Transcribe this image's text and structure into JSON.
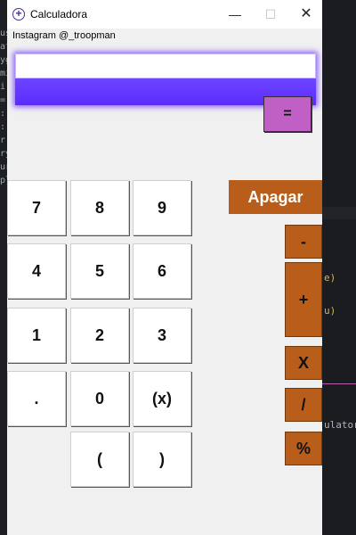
{
  "window": {
    "title": "Calculadora",
    "minimize": "—",
    "maximize": "☐",
    "close": "✕"
  },
  "subtitle": "Instagram @_troopman",
  "display": {
    "value": ""
  },
  "buttons": {
    "equals": "=",
    "clear": "Apagar",
    "digits": {
      "seven": "7",
      "eight": "8",
      "nine": "9",
      "four": "4",
      "five": "5",
      "six": "6",
      "one": "1",
      "two": "2",
      "three": "3",
      "dot": ".",
      "zero": "0",
      "x": "(x)",
      "open_paren": "(",
      "close_paren": ")"
    },
    "ops": {
      "minus": "-",
      "plus": "+",
      "multiply": "X",
      "divide": "/",
      "percent": "%"
    }
  },
  "background_code": {
    "right_snippets": [
      "e)",
      "u)",
      "ulator"
    ]
  },
  "colors": {
    "equals": "#c05fc4",
    "operator": "#b85d1a",
    "display_bar": "#5b2bff"
  }
}
